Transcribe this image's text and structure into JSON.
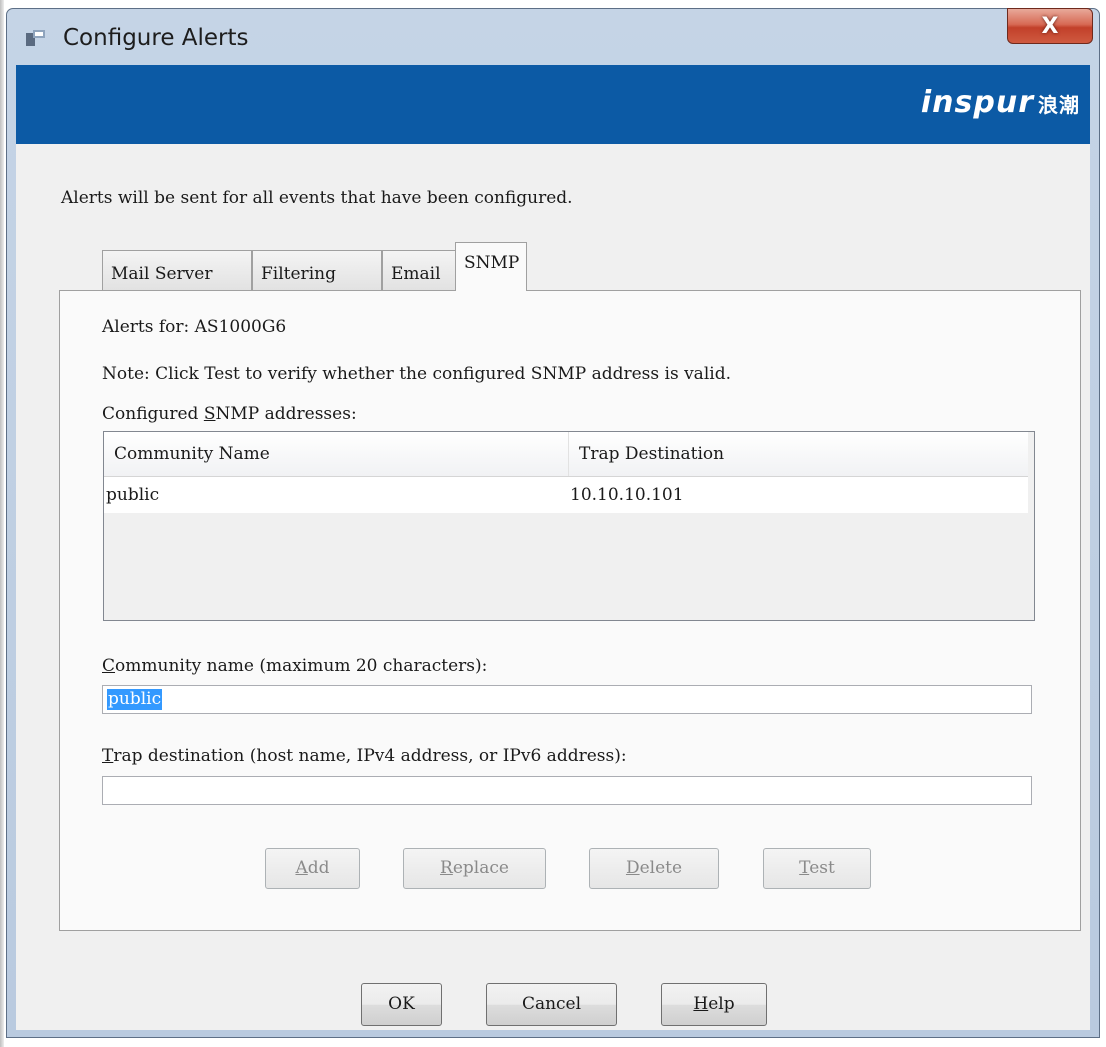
{
  "window": {
    "title": "Configure Alerts",
    "close_label": "X"
  },
  "banner": {
    "brand_text": "inspur",
    "brand_cn": "浪潮"
  },
  "intro": "Alerts will be sent for all events that have been configured.",
  "tabs": [
    {
      "label": "Mail Server",
      "active": false
    },
    {
      "label": "Filtering",
      "active": false
    },
    {
      "label": "Email",
      "active": false
    },
    {
      "label": "SNMP",
      "active": true
    }
  ],
  "snmp": {
    "alerts_for": "Alerts for: AS1000G6",
    "note": "Note: Click Test to verify whether the configured SNMP address is valid.",
    "addresses_label_prefix": "Configured ",
    "addresses_label_mnemonic": "S",
    "addresses_label_suffix": "NMP addresses:",
    "columns": [
      "Community Name",
      "Trap Destination"
    ],
    "rows": [
      {
        "community": "public",
        "destination": "10.10.10.101"
      }
    ],
    "community_label_mnemonic": "C",
    "community_label_rest": "ommunity name (maximum 20 characters):",
    "community_value": "public",
    "trap_label_mnemonic": "T",
    "trap_label_rest": "rap destination (host name, IPv4 address, or IPv6 address):",
    "trap_value": "",
    "buttons": {
      "add_mnemonic": "A",
      "add_rest": "dd",
      "replace_mnemonic": "R",
      "replace_rest": "eplace",
      "delete_mnemonic": "D",
      "delete_rest": "elete",
      "test_mnemonic": "T",
      "test_rest": "est"
    }
  },
  "footer": {
    "ok": "OK",
    "cancel": "Cancel",
    "help_mnemonic": "H",
    "help_rest": "elp"
  },
  "colors": {
    "banner": "#0c5aa5",
    "selection": "#3399ff",
    "close_button": "#c2402a"
  }
}
